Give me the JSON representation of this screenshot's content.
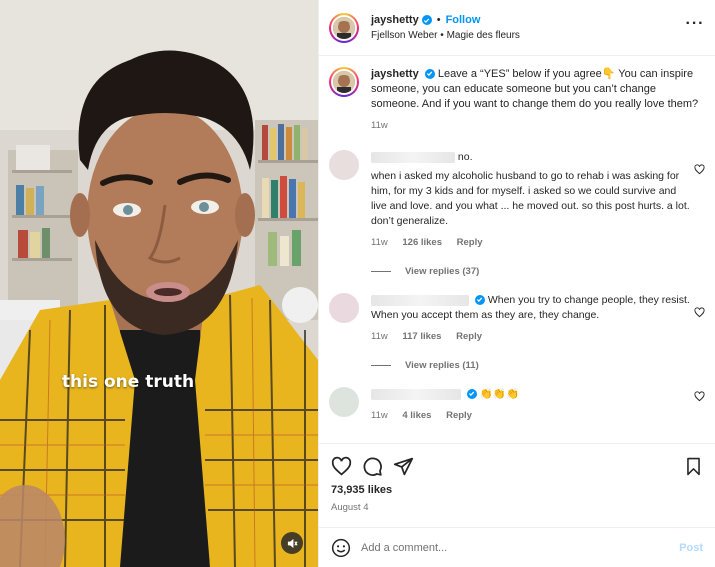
{
  "video": {
    "caption_text": "this one truth",
    "mute_icon": "speaker-muted-icon"
  },
  "header": {
    "username": "jayshetty",
    "separator": "•",
    "follow_label": "Follow",
    "audio": "Fjellson Weber • Magie des fleurs",
    "more_icon": "more-horizontal-icon"
  },
  "post_caption": {
    "username": "jayshetty",
    "text": "Leave a “YES” below if you agree👇 You can inspire someone, you can educate someone but you can’t change someone. And if you want to change them do you really love them?",
    "age": "11w"
  },
  "comments": [
    {
      "text_suffix": " no.",
      "body": "when i asked my alcoholic husband to go to rehab i was asking for him, for my 3 kids and for myself. i asked so we could survive and live and love. and you what ... he moved out. so this post hurts. a lot. don’t generalize.",
      "age": "11w",
      "likes": "126 likes",
      "reply": "Reply",
      "view_replies": "View replies (37)"
    },
    {
      "text": "When you try to change people, they resist. When you accept them as they are, they change.",
      "age": "11w",
      "likes": "117 likes",
      "reply": "Reply",
      "view_replies": "View replies (11)"
    },
    {
      "text": "👏👏👏",
      "age": "11w",
      "likes": "4 likes",
      "reply": "Reply"
    }
  ],
  "actions": {
    "like_icon": "heart-icon",
    "comment_icon": "comment-icon",
    "share_icon": "send-icon",
    "save_icon": "bookmark-icon",
    "likes": "73,935 likes",
    "date": "August 4"
  },
  "add_comment": {
    "placeholder": "Add a comment...",
    "post_label": "Post",
    "emoji_icon": "emoji-icon"
  },
  "colors": {
    "link": "#0095f6",
    "muted": "#737373",
    "post_disabled": "#b3dbff",
    "jacket": "#e8b51e"
  }
}
